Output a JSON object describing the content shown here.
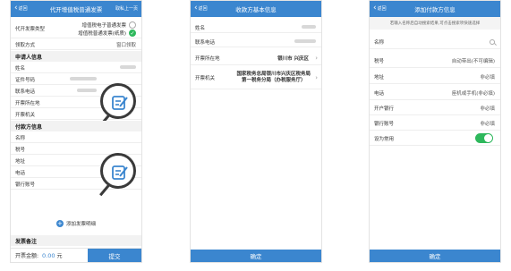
{
  "screen1": {
    "back": "返回",
    "title": "代开增值税普通发票",
    "right": "取私上一页",
    "invoice_type_label": "代开发票类型",
    "invoice_type_options": [
      "增值税电子普通发票",
      "增值税普通发票(纸质)"
    ],
    "pickup_label": "领取方式",
    "pickup_value": "窗口领取",
    "applicant_section": "申请人信息",
    "applicant_fields": [
      "姓名",
      "证件号码",
      "联系电话",
      "开票所在地",
      "开票机关"
    ],
    "payer_section": "付款方信息",
    "payer_fields": [
      "名称",
      "税号",
      "地址",
      "电话",
      "银行账号"
    ],
    "add_detail": "添加发票明细",
    "remark_section": "发票备注",
    "amount_label": "开票金额:",
    "amount_value": "0.00",
    "amount_unit": "元",
    "submit": "提交"
  },
  "screen2": {
    "back": "返回",
    "title": "收款方基本信息",
    "name_label": "姓名",
    "phone_label": "联系电话",
    "location_label": "开票所在地",
    "location_value": "银川市 兴庆区",
    "office_label": "开票机关",
    "office_value_1": "国家税务总局银川市兴庆区税务局",
    "office_value_2": "第一税务分局（办税服务厅）",
    "confirm": "确定"
  },
  "screen3": {
    "back": "返回",
    "title": "添加付款方信息",
    "hint": "若输入名称后自动搜索结果,可点击搜索项快速选择",
    "rows": [
      {
        "label": "名称",
        "value": ""
      },
      {
        "label": "税号",
        "value": "自动带出(不可编辑)"
      },
      {
        "label": "地址",
        "value": "非必填"
      },
      {
        "label": "电话",
        "value": "座机或手机(非必填)"
      },
      {
        "label": "开户银行",
        "value": "非必填"
      },
      {
        "label": "银行账号",
        "value": "非必填"
      }
    ],
    "set_common_label": "设为常用",
    "confirm": "确定"
  },
  "colors": {
    "primary": "#3b86cf",
    "toggle_on": "#2eb85c"
  }
}
